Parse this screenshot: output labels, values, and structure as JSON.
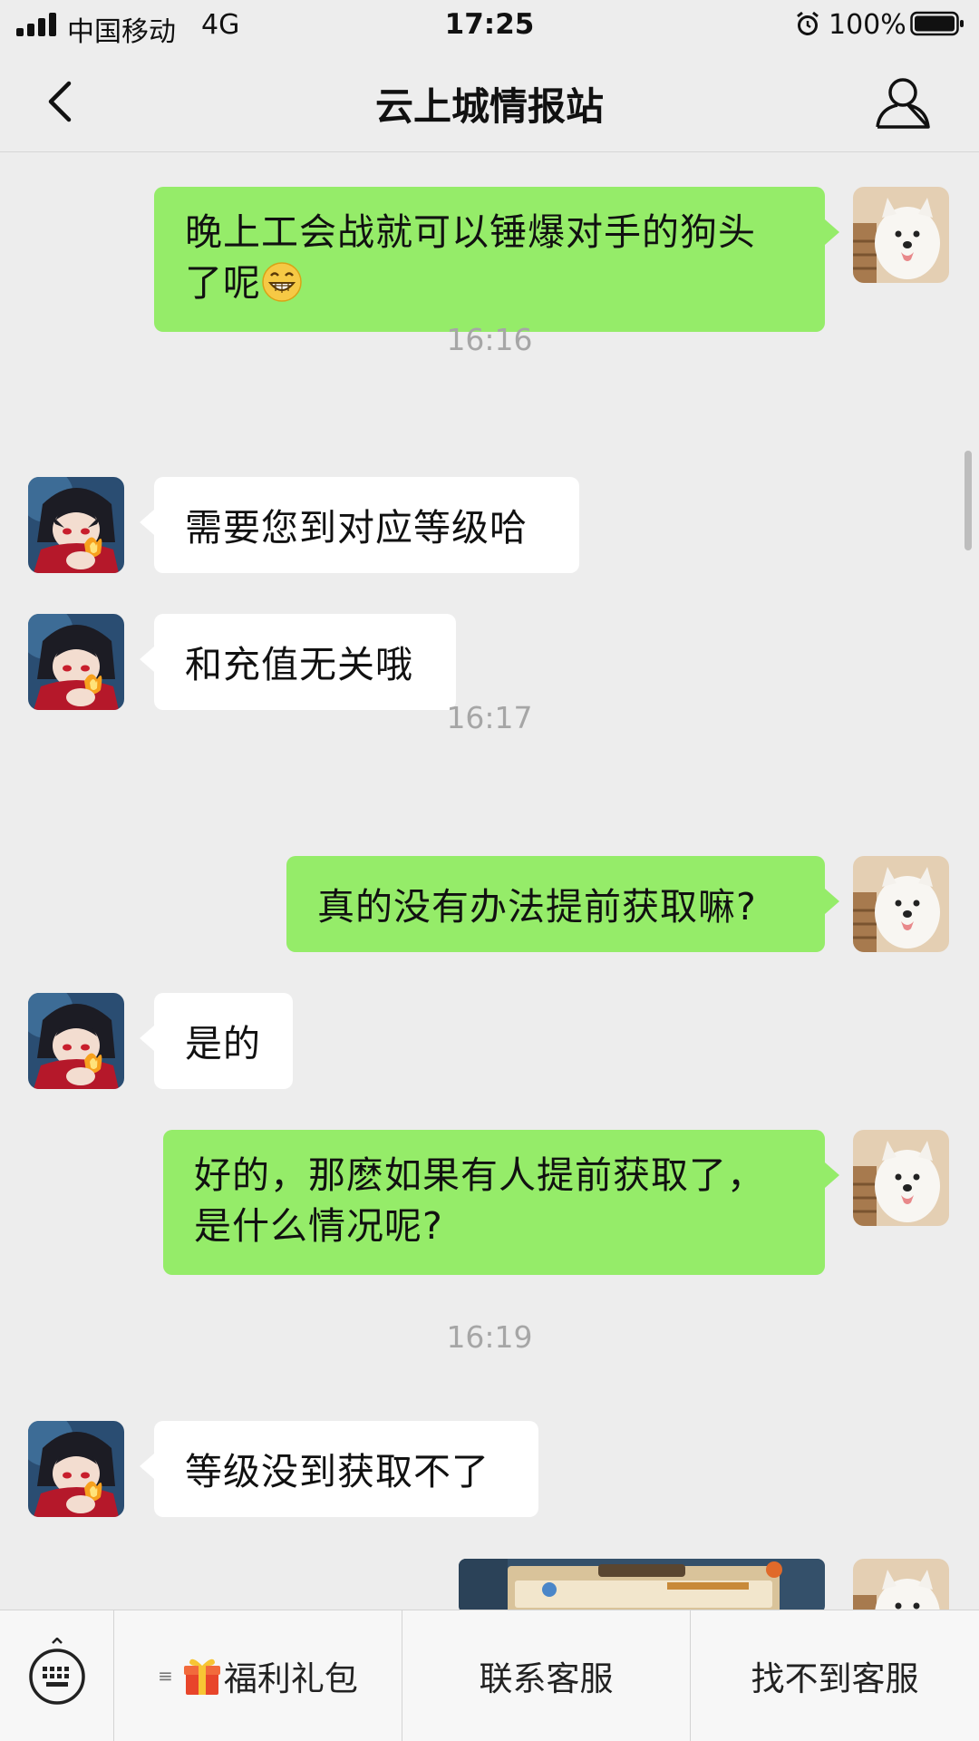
{
  "status_bar": {
    "carrier": "中国移动",
    "network": "4G",
    "time": "17:25",
    "battery": "100%",
    "icons": [
      "signal-icon",
      "alarm-icon",
      "battery-icon"
    ]
  },
  "nav": {
    "title": "云上城情报站",
    "icons": [
      "back-icon",
      "profile-icon"
    ]
  },
  "messages": [
    {
      "side": "out",
      "text_1": "晚上工会战就可以锤爆对手的狗头",
      "text_2": "了呢",
      "emoji": "grinning-emoji"
    },
    {
      "timestamp": "16:16"
    },
    {
      "side": "in",
      "text": "需要您到对应等级哈"
    },
    {
      "side": "in",
      "text": "和充值无关哦"
    },
    {
      "timestamp": "16:17"
    },
    {
      "side": "out",
      "text": "真的没有办法提前获取嘛?"
    },
    {
      "side": "in",
      "text": "是的"
    },
    {
      "side": "out",
      "text_1": "好的，那麽如果有人提前获取了，",
      "text_2": "是什么情况呢?"
    },
    {
      "timestamp": "16:19"
    },
    {
      "side": "in",
      "text": "等级没到获取不了"
    },
    {
      "side": "out",
      "type": "image",
      "image": "game-screenshot-thumbnail"
    }
  ],
  "menu": {
    "keyboard_icon": "keyboard-icon",
    "sub_mark": "≡",
    "gift_icon": "gift-icon",
    "items": [
      "福利礼包",
      "联系客服",
      "找不到客服"
    ]
  },
  "colors": {
    "background": "#ededed",
    "bubble_out": "#95ec69",
    "bubble_in": "#ffffff",
    "timestamp": "#a6a6a6"
  }
}
